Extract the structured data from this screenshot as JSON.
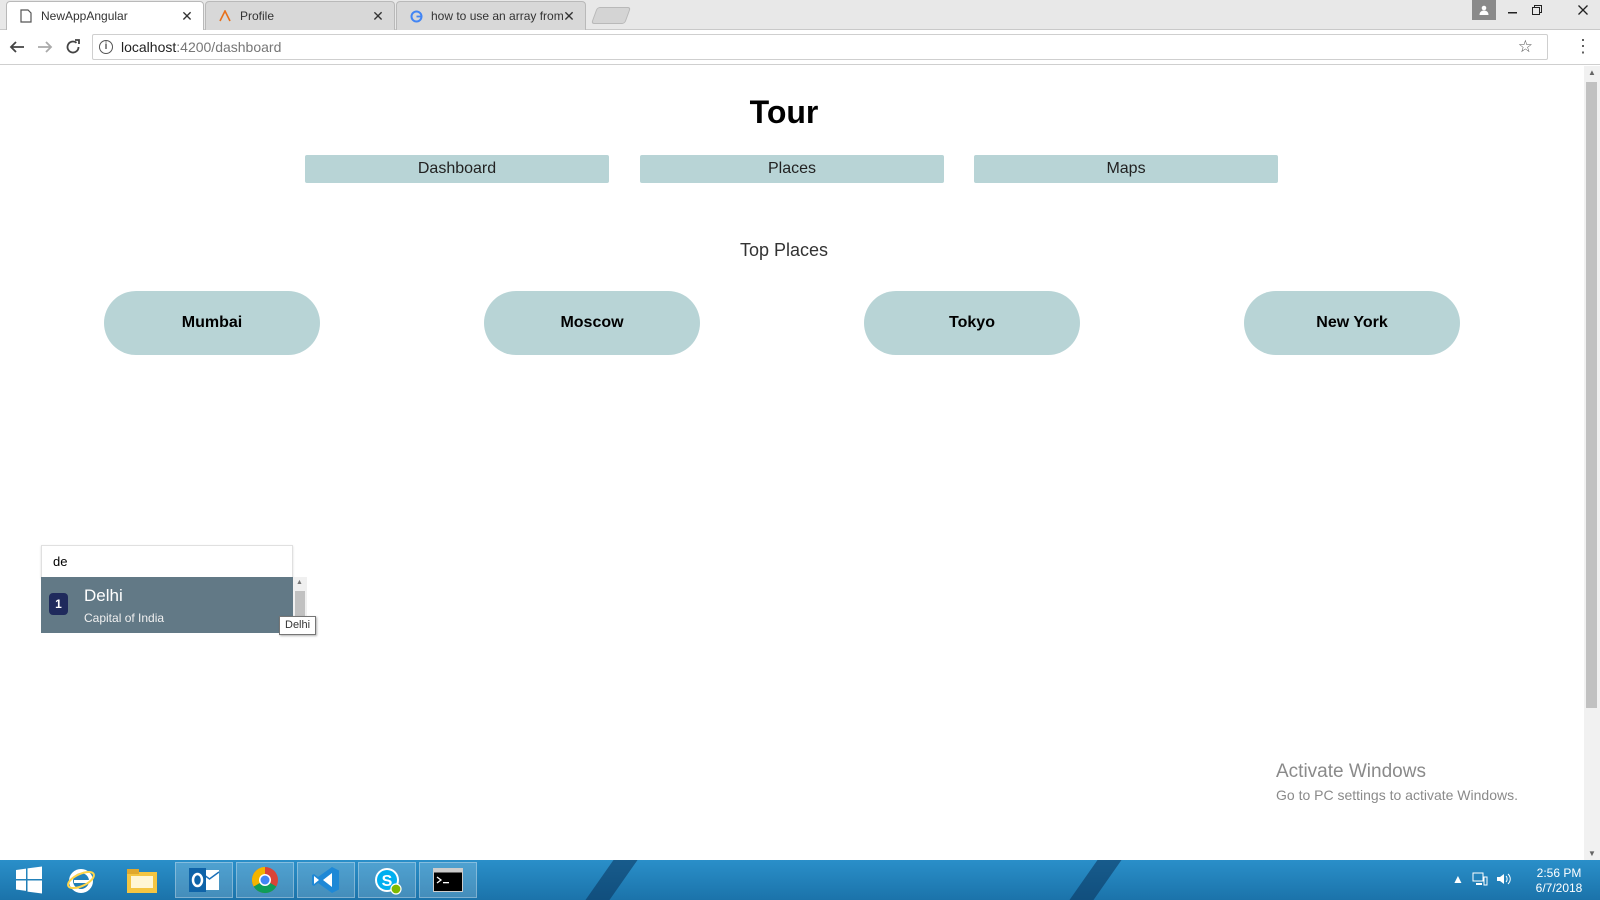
{
  "browser": {
    "tabs": [
      {
        "title": "NewAppAngular",
        "active": true
      },
      {
        "title": "Profile",
        "active": false
      },
      {
        "title": "how to use an array from",
        "active": false
      }
    ],
    "address": {
      "host": "localhost",
      "path": ":4200/dashboard"
    }
  },
  "app": {
    "title": "Tour",
    "nav": [
      "Dashboard",
      "Places",
      "Maps"
    ],
    "section_title": "Top Places",
    "places": [
      "Mumbai",
      "Moscow",
      "Tokyo",
      "New York"
    ]
  },
  "search": {
    "value": "de",
    "results": [
      {
        "index": "1",
        "name": "Delhi",
        "description": "Capital of India"
      }
    ],
    "tooltip": "Delhi"
  },
  "watermark": {
    "line1": "Activate Windows",
    "line2": "Go to PC settings to activate Windows."
  },
  "taskbar": {
    "time": "2:56 PM",
    "date": "6/7/2018"
  },
  "colors": {
    "accent": "#b8d4d6",
    "result_bg": "#627986",
    "badge_bg": "#1f2a5c",
    "taskbar": "#2384bf"
  }
}
